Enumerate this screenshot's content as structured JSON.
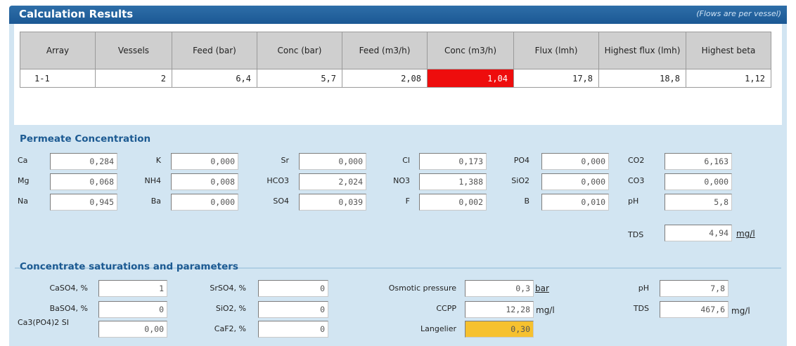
{
  "header": {
    "title": "Calculation Results",
    "note": "(Flows are per vessel)"
  },
  "results": {
    "columns": [
      "Array",
      "Vessels",
      "Feed (bar)",
      "Conc (bar)",
      "Feed (m3/h)",
      "Conc (m3/h)",
      "Flux (lmh)",
      "Highest flux (lmh)",
      "Highest beta"
    ],
    "row": [
      "1-1",
      "2",
      "6,4",
      "5,7",
      "2,08",
      "1,04",
      "17,8",
      "18,8",
      "1,12"
    ],
    "alert_color": "#ee0d0d"
  },
  "permeate": {
    "title": "Permeate Concentration",
    "items": {
      "ca": {
        "label": "Ca",
        "value": "0,284"
      },
      "mg": {
        "label": "Mg",
        "value": "0,068"
      },
      "na": {
        "label": "Na",
        "value": "0,945"
      },
      "k": {
        "label": "K",
        "value": "0,000"
      },
      "nh4": {
        "label": "NH4",
        "value": "0,008"
      },
      "ba": {
        "label": "Ba",
        "value": "0,000"
      },
      "sr": {
        "label": "Sr",
        "value": "0,000"
      },
      "hco3": {
        "label": "HCO3",
        "value": "2,024"
      },
      "so4": {
        "label": "SO4",
        "value": "0,039"
      },
      "cl": {
        "label": "Cl",
        "value": "0,173"
      },
      "no3": {
        "label": "NO3",
        "value": "1,388"
      },
      "f": {
        "label": "F",
        "value": "0,002"
      },
      "po4": {
        "label": "PO4",
        "value": "0,000"
      },
      "sio2": {
        "label": "SiO2",
        "value": "0,000"
      },
      "b": {
        "label": "B",
        "value": "0,010"
      },
      "co2": {
        "label": "CO2",
        "value": "6,163"
      },
      "co3": {
        "label": "CO3",
        "value": "0,000"
      },
      "ph": {
        "label": "pH",
        "value": "5,8"
      },
      "tds": {
        "label": "TDS",
        "value": "4,94",
        "unit": "mg/l"
      }
    }
  },
  "concentrate": {
    "title": "Concentrate saturations and parameters",
    "caso4": {
      "label": "CaSO4, %",
      "value": "1"
    },
    "baso4": {
      "label": "BaSO4, %",
      "value": "0"
    },
    "ca3po4": {
      "label": "Ca3(PO4)2 SI",
      "value": "0,00"
    },
    "srso4": {
      "label": "SrSO4, %",
      "value": "0"
    },
    "sio2": {
      "label": "SiO2, %",
      "value": "0"
    },
    "caf2": {
      "label": "CaF2, %",
      "value": "0"
    },
    "osmotic": {
      "label": "Osmotic pressure",
      "value": "0,3",
      "unit": "bar"
    },
    "ccpp": {
      "label": "CCPP",
      "value": "12,28",
      "unit": "mg/l"
    },
    "langelier": {
      "label": "Langelier",
      "value": "0,30",
      "color": "#f6c12f"
    },
    "ph": {
      "label": "pH",
      "value": "7,8"
    },
    "tds": {
      "label": "TDS",
      "value": "467,6",
      "unit": "mg/l"
    }
  }
}
